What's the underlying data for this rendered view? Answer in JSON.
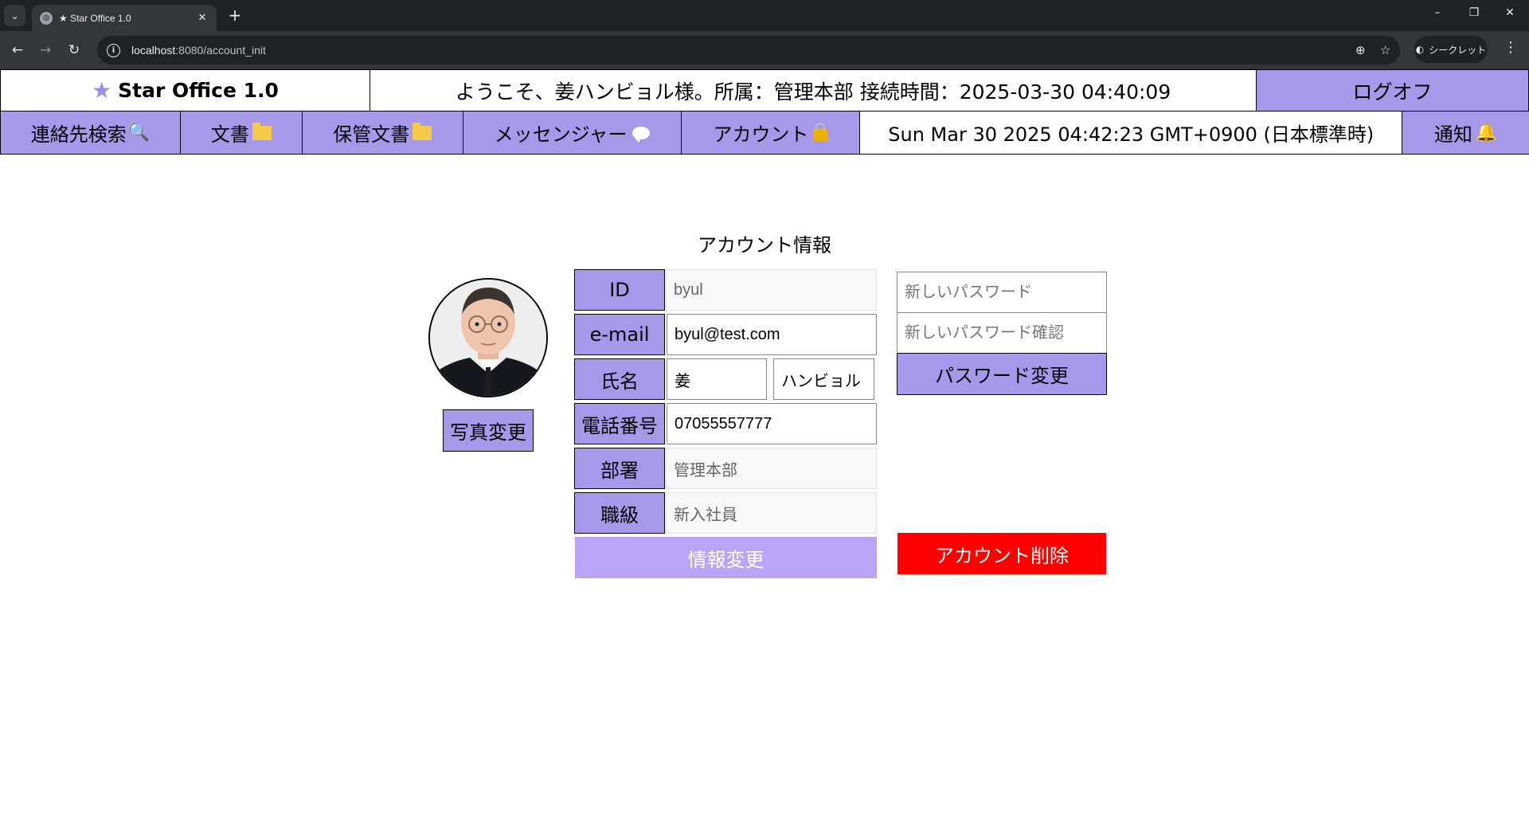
{
  "browser": {
    "tab_title": "★ Star Office 1.0",
    "url_host": "localhost",
    "url_path": ":8080/account_init",
    "incognito_label": "シークレット"
  },
  "header": {
    "logo_text": "Star Office 1.0",
    "welcome": "ようこそ、姜ハンビョル様。所属：管理本部 接続時間：2025-03-30 04:40:09",
    "logoff": "ログオフ"
  },
  "nav": {
    "contacts": "連絡先検索",
    "documents": "文書",
    "archived": "保管文書",
    "messenger": "メッセンジャー",
    "account": "アカウント",
    "clock": "Sun Mar 30 2025 04:42:23 GMT+0900 (日本標準時)",
    "notify": "通知"
  },
  "account": {
    "title": "アカウント情報",
    "photo_change": "写真変更",
    "labels": {
      "id": "ID",
      "email": "e-mail",
      "name": "氏名",
      "phone": "電話番号",
      "dept": "部署",
      "rank": "職級"
    },
    "values": {
      "id": "byul",
      "email": "byul@test.com",
      "last_name": "姜",
      "first_name": "ハンビョル",
      "phone": "07055557777",
      "dept": "管理本部",
      "rank": "新入社員"
    },
    "info_change": "情報変更",
    "new_password_placeholder": "新しいパスワード",
    "confirm_password_placeholder": "新しいパスワード確認",
    "password_change": "パスワード変更",
    "delete_account": "アカウント削除"
  },
  "colors": {
    "accent_purple": "#a699ea",
    "info_button": "#b9a4fa",
    "danger": "#ff0000"
  }
}
